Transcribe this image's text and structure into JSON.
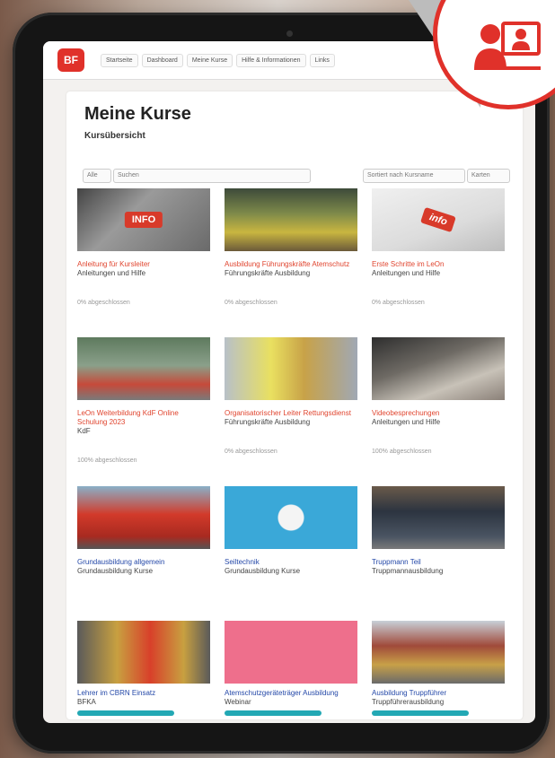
{
  "nav": {
    "items": [
      "Startseite",
      "Dashboard",
      "Meine Kurse",
      "Hilfe & Informationen",
      "Links"
    ]
  },
  "page": {
    "title": "Meine Kurse",
    "subtitle": "Kursübersicht"
  },
  "filters": {
    "all": "Alle",
    "search_placeholder": "Suchen",
    "sort": "Sortiert nach Kursname",
    "view": "Karten"
  },
  "courses": [
    {
      "image_label": "INFO",
      "title": "Anleitung für Kursleiter",
      "category": "Anleitungen und Hilfe",
      "progress": "0% abgeschlossen",
      "title_color": "red"
    },
    {
      "image_label": "",
      "title": "Ausbildung Führungskräfte Atemschutz",
      "category": "Führungskräfte Ausbildung",
      "progress": "0% abgeschlossen",
      "title_color": "red"
    },
    {
      "image_label": "info",
      "title": "Erste Schritte im LeOn",
      "category": "Anleitungen und Hilfe",
      "progress": "0% abgeschlossen",
      "title_color": "red"
    },
    {
      "image_label": "",
      "title": "LeOn Weiterbildung KdF Online Schulung 2023",
      "category": "KdF",
      "progress": "100% abgeschlossen",
      "title_color": "red"
    },
    {
      "image_label": "",
      "title": "Organisatorischer Leiter Rettungsdienst",
      "category": "Führungskräfte Ausbildung",
      "progress": "0% abgeschlossen",
      "title_color": "red"
    },
    {
      "image_label": "",
      "title": "Videobesprechungen",
      "category": "Anleitungen und Hilfe",
      "progress": "100% abgeschlossen",
      "title_color": "red"
    },
    {
      "image_label": "",
      "title": "Grundausbildung allgemein",
      "category": "Grundausbildung Kurse",
      "progress": "",
      "title_color": "blue"
    },
    {
      "image_label": "",
      "title": "Seiltechnik",
      "category": "Grundausbildung Kurse",
      "progress": "",
      "title_color": "blue"
    },
    {
      "image_label": "",
      "title": "Truppmann Teil",
      "category": "Truppmannausbildung",
      "progress": "",
      "title_color": "blue"
    },
    {
      "image_label": "",
      "title": "Lehrer im CBRN Einsatz",
      "category": "BFKA",
      "progress": "",
      "title_color": "blue"
    },
    {
      "image_label": "",
      "title": "Atemschutzgeräteträger Ausbildung",
      "category": "Webinar",
      "progress": "",
      "title_color": "blue"
    },
    {
      "image_label": "",
      "title": "Ausbildung Truppführer",
      "category": "Truppführerausbildung",
      "progress": "",
      "title_color": "blue"
    }
  ],
  "colors": {
    "accent": "#e0312a",
    "link_blue": "#2448a8",
    "progress_teal": "#23a8b4"
  },
  "badge": {
    "icon": "presenter-user-icon"
  }
}
